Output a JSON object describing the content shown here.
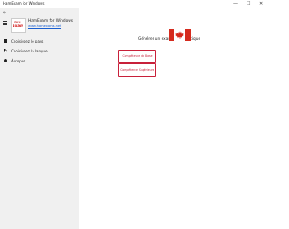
{
  "window": {
    "title": "HamExam for Windows",
    "controls": {
      "minimize": "—",
      "maximize": "☐",
      "close": "✕"
    }
  },
  "sidebar": {
    "back_glyph": "←",
    "app_name": "HamExam for Windows",
    "app_link": "www.hamexams.net",
    "logo": {
      "line1": "Mara",
      "line2": "Exam"
    },
    "items": [
      {
        "label": "Choisissez le pays",
        "icon": "grid-icon"
      },
      {
        "label": "Choisissez la langue",
        "icon": "language-icon"
      },
      {
        "label": "Àpropos",
        "icon": "info-icon"
      }
    ]
  },
  "main": {
    "title": "Générer un examen de pratique",
    "flag": "canada-flag-icon",
    "buttons": [
      {
        "label": "Compétence de Base"
      },
      {
        "label": "Compétence Supérieure"
      }
    ]
  },
  "colors": {
    "accent": "#c8203a",
    "flag_red": "#d52b1e",
    "sidebar_bg": "#f0f0f0",
    "link": "#1a5fd0"
  }
}
